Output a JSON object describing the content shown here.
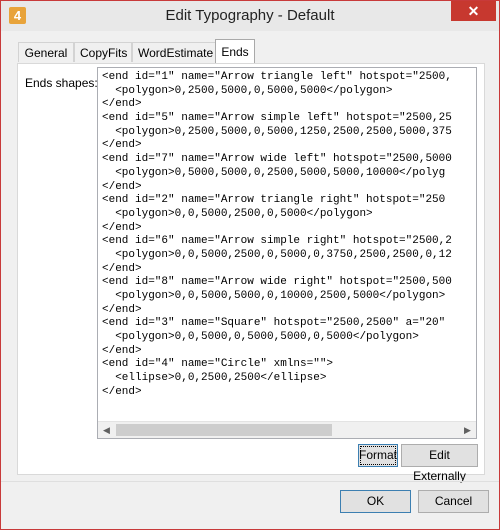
{
  "window": {
    "title": "Edit Typography - Default",
    "app_icon_glyph": "4",
    "close_glyph": "✕",
    "accent": "#c7382f"
  },
  "tabs": [
    {
      "label": "General",
      "active": false
    },
    {
      "label": "CopyFits",
      "active": false
    },
    {
      "label": "WordEstimate",
      "active": false
    },
    {
      "label": "Ends",
      "active": true
    }
  ],
  "ends": {
    "label": "Ends shapes:",
    "lines": [
      "<end id=\"1\" name=\"Arrow triangle left\" hotspot=\"2500,",
      "  <polygon>0,2500,5000,0,5000,5000</polygon>",
      "</end>",
      "<end id=\"5\" name=\"Arrow simple left\" hotspot=\"2500,25",
      "  <polygon>0,2500,5000,0,5000,1250,2500,2500,5000,375",
      "</end>",
      "<end id=\"7\" name=\"Arrow wide left\" hotspot=\"2500,5000",
      "  <polygon>0,5000,5000,0,2500,5000,5000,10000</polyg",
      "</end>",
      "<end id=\"2\" name=\"Arrow triangle right\" hotspot=\"250",
      "  <polygon>0,0,5000,2500,0,5000</polygon>",
      "</end>",
      "<end id=\"6\" name=\"Arrow simple right\" hotspot=\"2500,2",
      "  <polygon>0,0,5000,2500,0,5000,0,3750,2500,2500,0,12",
      "</end>",
      "<end id=\"8\" name=\"Arrow wide right\" hotspot=\"2500,500",
      "  <polygon>0,0,5000,5000,0,10000,2500,5000</polygon>",
      "</end>",
      "<end id=\"3\" name=\"Square\" hotspot=\"2500,2500\" a=\"20\"",
      "  <polygon>0,0,5000,0,5000,5000,0,5000</polygon>",
      "</end>",
      "<end id=\"4\" name=\"Circle\" xmlns=\"\">",
      "  <ellipse>0,0,2500,2500</ellipse>",
      "</end>"
    ]
  },
  "scrollbar": {
    "left_arrow": "◀",
    "right_arrow": "▶"
  },
  "buttons": {
    "format": "Format",
    "edit_externally": "Edit Externally",
    "ok": "OK",
    "cancel": "Cancel"
  }
}
